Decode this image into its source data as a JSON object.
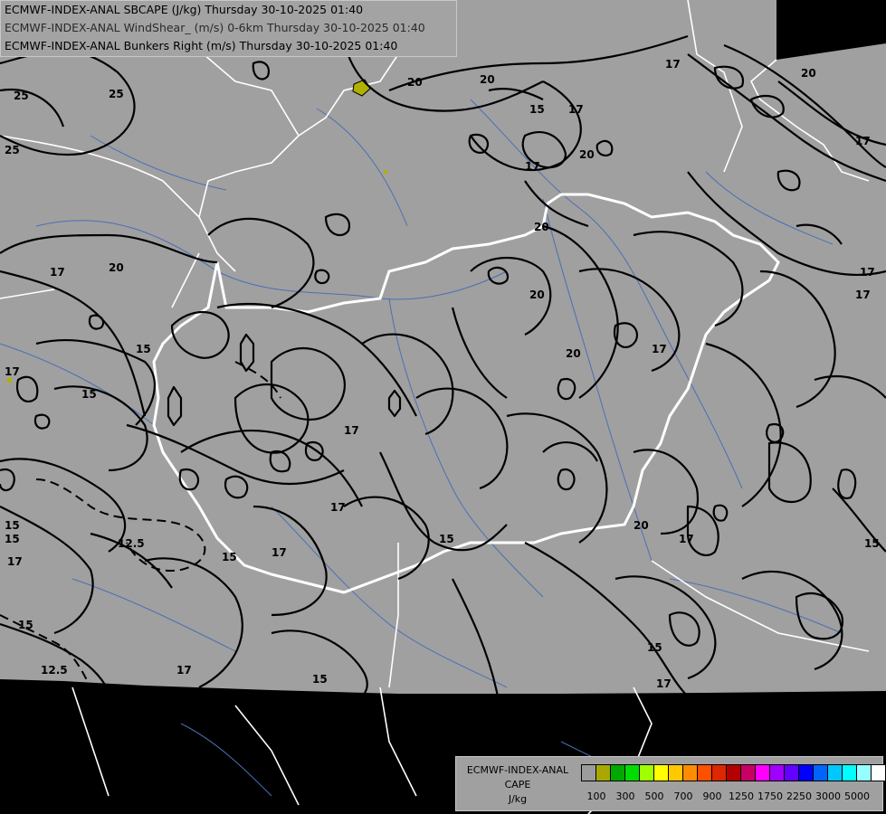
{
  "title_lines": [
    "ECMWF-INDEX-ANAL SBCAPE (J/kg) Thursday 30-10-2025 01:40",
    "ECMWF-INDEX-ANAL WindShear_ (m/s) 0-6km Thursday 30-10-2025 01:40",
    "ECMWF-INDEX-ANAL Bunkers Right (m/s) Thursday 30-10-2025 01:40"
  ],
  "legend": {
    "title": [
      "ECMWF-INDEX-ANAL",
      "CAPE",
      "J/kg"
    ],
    "colors": [
      "#9c9c9c",
      "#a8a800",
      "#00a800",
      "#00dc00",
      "#a0ff00",
      "#ffff00",
      "#ffc800",
      "#ff8c00",
      "#ff5000",
      "#dc2800",
      "#b40000",
      "#c80064",
      "#ff00ff",
      "#a000ff",
      "#6400ff",
      "#0000ff",
      "#0064ff",
      "#00c8ff",
      "#00ffff",
      "#96ffff",
      "#ffffff"
    ],
    "ticks": [
      "100",
      "300",
      "500",
      "700",
      "900",
      "1250",
      "1750",
      "2250",
      "3000",
      "5000"
    ]
  },
  "contour_labels": [
    "25",
    "25",
    "25",
    "20",
    "20",
    "20",
    "17",
    "17",
    "17",
    "15",
    "17",
    "20",
    "20",
    "17",
    "15",
    "15",
    "17",
    "20",
    "20",
    "20",
    "17",
    "17",
    "15",
    "12.5",
    "12.5",
    "15",
    "15",
    "17",
    "17",
    "15",
    "17",
    "17",
    "15",
    "17",
    "15",
    "17",
    "20",
    "17",
    "15",
    "17",
    "15"
  ],
  "colors": {
    "domain_fill": "#a0a0a0",
    "outside": "#000000",
    "border": "#ffffff",
    "river": "#4a6fb5",
    "contour": "#000000"
  }
}
